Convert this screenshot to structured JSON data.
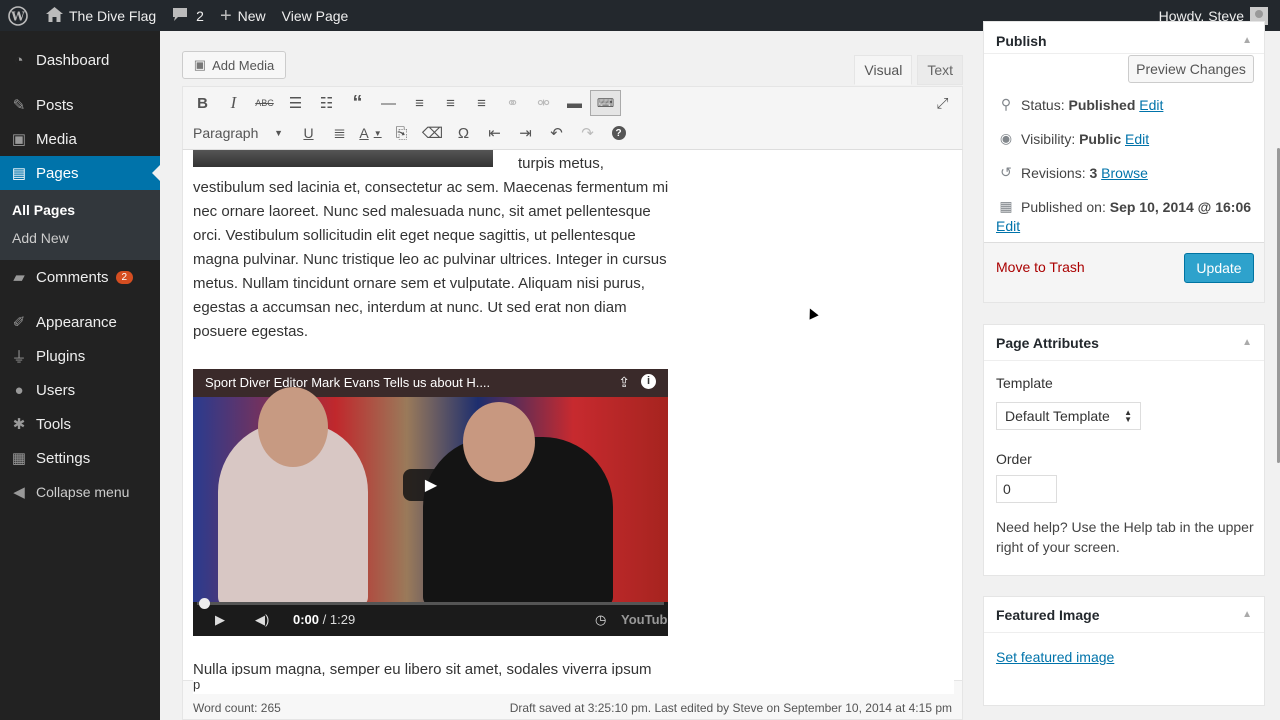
{
  "adminbar": {
    "site_name": "The Dive Flag",
    "comments_count": "2",
    "new_label": "New",
    "view_label": "View Page",
    "howdy": "Howdy, Steve"
  },
  "sidebar": {
    "items": [
      {
        "label": "Dashboard",
        "icon": "dashboard-icon"
      },
      {
        "label": "Posts",
        "icon": "pin-icon"
      },
      {
        "label": "Media",
        "icon": "media-icon"
      },
      {
        "label": "Pages",
        "icon": "pages-icon"
      },
      {
        "label": "Comments",
        "icon": "comment-icon",
        "badge": "2"
      },
      {
        "label": "Appearance",
        "icon": "brush-icon"
      },
      {
        "label": "Plugins",
        "icon": "plug-icon"
      },
      {
        "label": "Users",
        "icon": "user-icon"
      },
      {
        "label": "Tools",
        "icon": "wrench-icon"
      },
      {
        "label": "Settings",
        "icon": "settings-icon"
      },
      {
        "label": "Collapse menu",
        "icon": "collapse-icon"
      }
    ],
    "submenu": [
      "All Pages",
      "Add New"
    ]
  },
  "editor": {
    "add_media": "Add Media",
    "tab_visual": "Visual",
    "tab_text": "Text",
    "format_select": "Paragraph",
    "text_fragment": "turpis metus,",
    "paragraph1": "vestibulum sed lacinia et, consectetur ac sem. Maecenas fermentum mi nec ornare laoreet. Nunc sed malesuada nunc, sit amet pellentesque orci. Vestibulum sollicitudin elit eget neque sagittis, ut pellentesque magna pulvinar. Nunc tristique leo ac pulvinar ultrices. Integer in cursus metus. Nullam tincidunt ornare sem et vulputate. Aliquam nisi purus, egestas a accumsan nec, interdum at nunc. Ut sed erat non diam posuere egestas.",
    "paragraph2": "Nulla ipsum magna, semper eu libero sit amet, sodales viverra ipsum",
    "path": "p",
    "word_count": "Word count: 265",
    "draft_saved": "Draft saved at 3:25:10 pm. Last edited by Steve on September 10, 2014 at 4:15 pm"
  },
  "video": {
    "title": "Sport Diver Editor Mark Evans Tells us about H....",
    "time": "0:00",
    "duration": "/ 1:29",
    "brand": "YouTube",
    "progress": 0
  },
  "publish": {
    "title": "Publish",
    "preview_button": "Preview Changes",
    "status_label": "Status:",
    "status_value": "Published",
    "visibility_label": "Visibility:",
    "visibility_value": "Public",
    "revisions_label": "Revisions:",
    "revisions_value": "3",
    "browse_link": "Browse",
    "published_label": "Published on:",
    "published_value": "Sep 10, 2014 @ 16:06",
    "edit_link": "Edit",
    "trash_link": "Move to Trash",
    "update_button": "Update"
  },
  "page_attributes": {
    "title": "Page Attributes",
    "template_label": "Template",
    "template_value": "Default Template",
    "order_label": "Order",
    "order_value": "0",
    "help_text": "Need help? Use the Help tab in the upper right of your screen."
  },
  "featured_image": {
    "title": "Featured Image",
    "set_link": "Set featured image"
  },
  "colors": {
    "admin_bar": "#23282d",
    "menu_current": "#0073aa",
    "update_button": "#2ea2cc",
    "trash": "#a00"
  }
}
